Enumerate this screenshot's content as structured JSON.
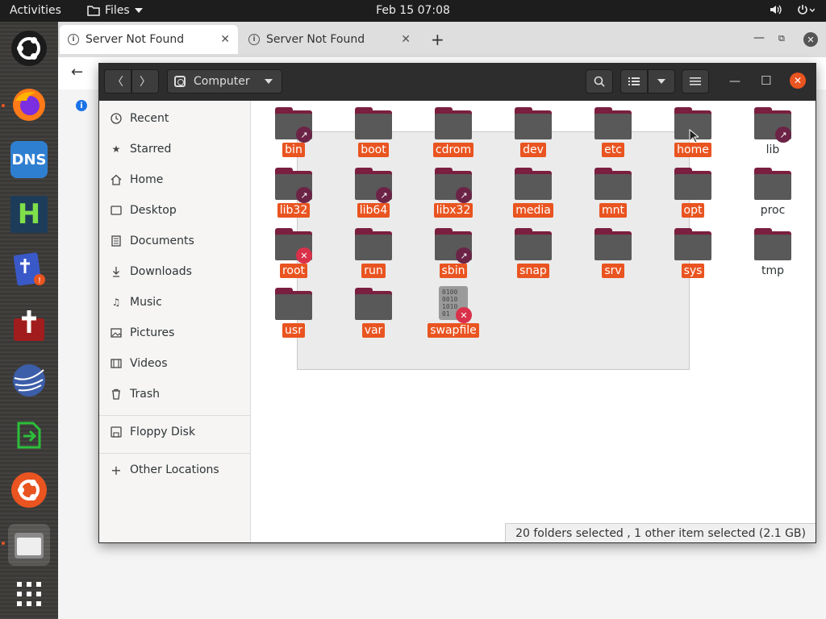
{
  "topbar": {
    "activities": "Activities",
    "app_menu": "Files",
    "clock": "Feb 15  07:08"
  },
  "browser": {
    "tabs": [
      {
        "label": "Server Not Found"
      },
      {
        "label": "Server Not Found"
      }
    ],
    "newtab": "+",
    "info_letter": "i"
  },
  "files": {
    "location": "Computer",
    "sidebar": [
      {
        "label": "Recent",
        "icon": "clock-icon"
      },
      {
        "label": "Starred",
        "icon": "star-icon"
      },
      {
        "label": "Home",
        "icon": "home-icon"
      },
      {
        "label": "Desktop",
        "icon": "desktop-icon"
      },
      {
        "label": "Documents",
        "icon": "documents-icon"
      },
      {
        "label": "Downloads",
        "icon": "downloads-icon"
      },
      {
        "label": "Music",
        "icon": "music-icon"
      },
      {
        "label": "Pictures",
        "icon": "pictures-icon"
      },
      {
        "label": "Videos",
        "icon": "videos-icon"
      },
      {
        "label": "Trash",
        "icon": "trash-icon"
      },
      {
        "label": "Floppy Disk",
        "icon": "floppy-icon"
      },
      {
        "label": "Other Locations",
        "icon": "plus-icon"
      }
    ],
    "items": [
      {
        "name": "bin",
        "selected": true,
        "emblem": "link"
      },
      {
        "name": "boot",
        "selected": true,
        "emblem": ""
      },
      {
        "name": "cdrom",
        "selected": true,
        "emblem": ""
      },
      {
        "name": "dev",
        "selected": true,
        "emblem": ""
      },
      {
        "name": "etc",
        "selected": true,
        "emblem": ""
      },
      {
        "name": "home",
        "selected": true,
        "emblem": ""
      },
      {
        "name": "lib",
        "selected": false,
        "emblem": "link"
      },
      {
        "name": "lib32",
        "selected": true,
        "emblem": "link"
      },
      {
        "name": "lib64",
        "selected": true,
        "emblem": "link"
      },
      {
        "name": "libx32",
        "selected": true,
        "emblem": "link"
      },
      {
        "name": "media",
        "selected": true,
        "emblem": ""
      },
      {
        "name": "mnt",
        "selected": true,
        "emblem": ""
      },
      {
        "name": "opt",
        "selected": true,
        "emblem": ""
      },
      {
        "name": "proc",
        "selected": false,
        "emblem": ""
      },
      {
        "name": "root",
        "selected": true,
        "emblem": "x"
      },
      {
        "name": "run",
        "selected": true,
        "emblem": ""
      },
      {
        "name": "sbin",
        "selected": true,
        "emblem": "link"
      },
      {
        "name": "snap",
        "selected": true,
        "emblem": ""
      },
      {
        "name": "srv",
        "selected": true,
        "emblem": ""
      },
      {
        "name": "sys",
        "selected": true,
        "emblem": ""
      },
      {
        "name": "tmp",
        "selected": false,
        "emblem": ""
      },
      {
        "name": "usr",
        "selected": true,
        "emblem": ""
      },
      {
        "name": "var",
        "selected": true,
        "emblem": ""
      },
      {
        "name": "swapfile",
        "selected": true,
        "emblem": "x",
        "kind": "file"
      }
    ],
    "binfile_text": "0100\n0010\n1010\n01",
    "status": "20 folders selected , 1 other item selected (2.1 GB)"
  },
  "dock": {
    "dns_label": "DNS",
    "h_label": "H"
  },
  "colors": {
    "accent": "#e95420",
    "folder": "#595959",
    "folder_tab": "#7a1f40"
  }
}
